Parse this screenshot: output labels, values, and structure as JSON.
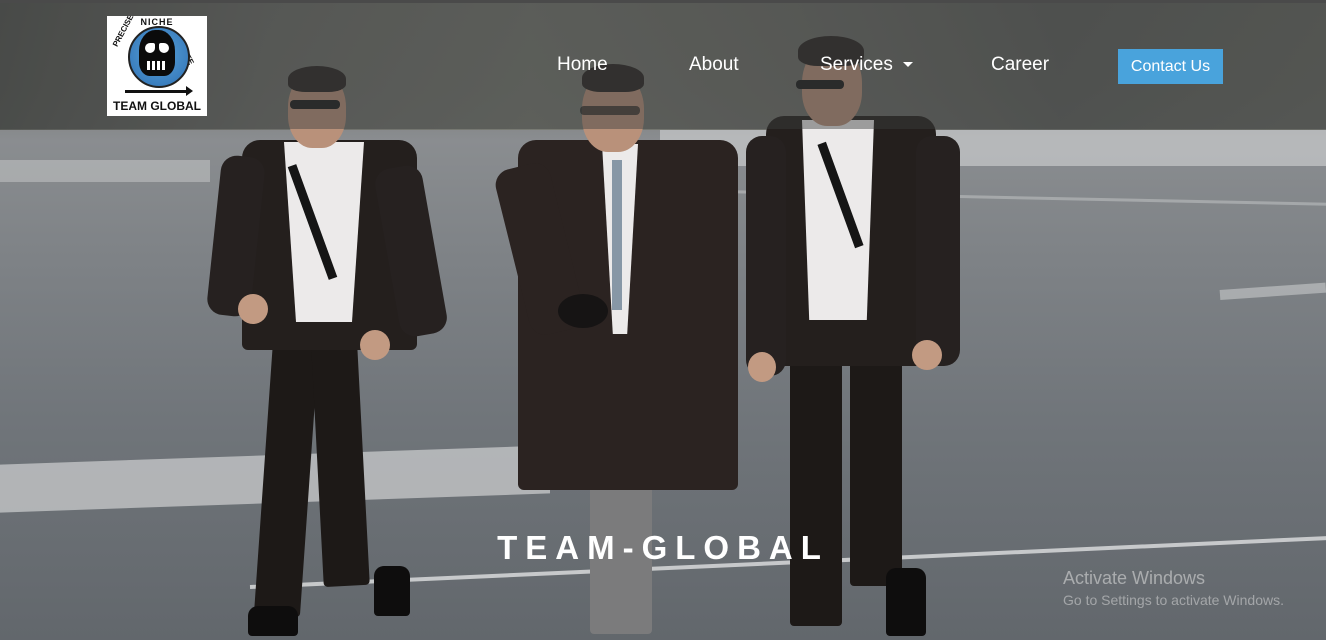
{
  "logo": {
    "top_text": "NICHE",
    "left_text": "PRECISE",
    "right_text": "ELITE",
    "bottom_text": "TEAM GLOBAL"
  },
  "nav": {
    "items": [
      {
        "label": "Home"
      },
      {
        "label": "About"
      },
      {
        "label": "Services",
        "icon": "caret-down-icon"
      },
      {
        "label": "Career"
      }
    ],
    "contact_label": "Contact Us"
  },
  "hero": {
    "title": "TEAM-GLOBAL"
  },
  "watermark": {
    "title": "Activate Windows",
    "subtitle": "Go to Settings to activate Windows."
  },
  "colors": {
    "accent": "#49a3dc",
    "nav_text": "#ffffff"
  }
}
